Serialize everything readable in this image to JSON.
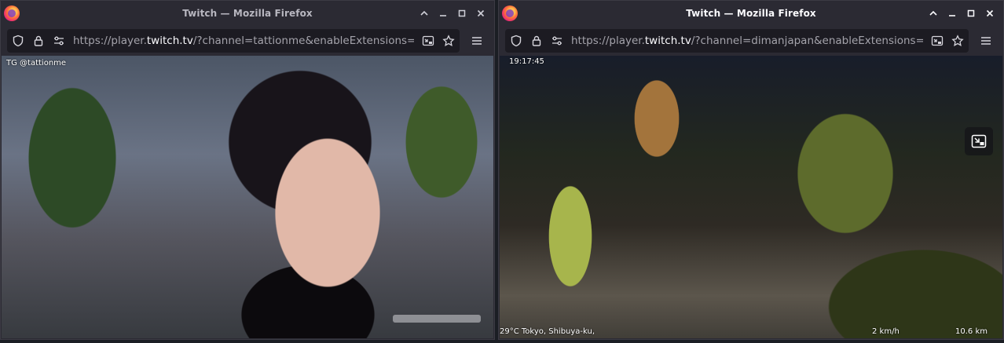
{
  "windows": [
    {
      "title": "Twitch — Mozilla Firefox",
      "url_prefix": "https://player.",
      "url_host": "twitch.tv",
      "url_suffix": "/?channel=tattionme&enableExtensions=tr",
      "overlay": {
        "handle": "TG @tattionme"
      }
    },
    {
      "title": "Twitch — Mozilla Firefox",
      "url_prefix": "https://player.",
      "url_host": "twitch.tv",
      "url_suffix": "/?channel=dimanjapan&enableExtensions=t",
      "overlay": {
        "time": "19:17:45",
        "temp_location": "29°C  Tokyo, Shibuya-ku,",
        "speed": "2 km/h",
        "distance": "10.6 km"
      }
    }
  ],
  "icons": {
    "shield": "shield-icon",
    "lock": "lock-icon",
    "permissions": "permissions-icon",
    "reader": "reader-view-icon",
    "bookmark": "bookmark-star-icon",
    "menu": "hamburger-menu-icon",
    "pip": "picture-in-picture-icon"
  },
  "colors": {
    "accent": "#ff7139",
    "chrome": "#2b2a33",
    "urlbar": "#1c1b22"
  }
}
